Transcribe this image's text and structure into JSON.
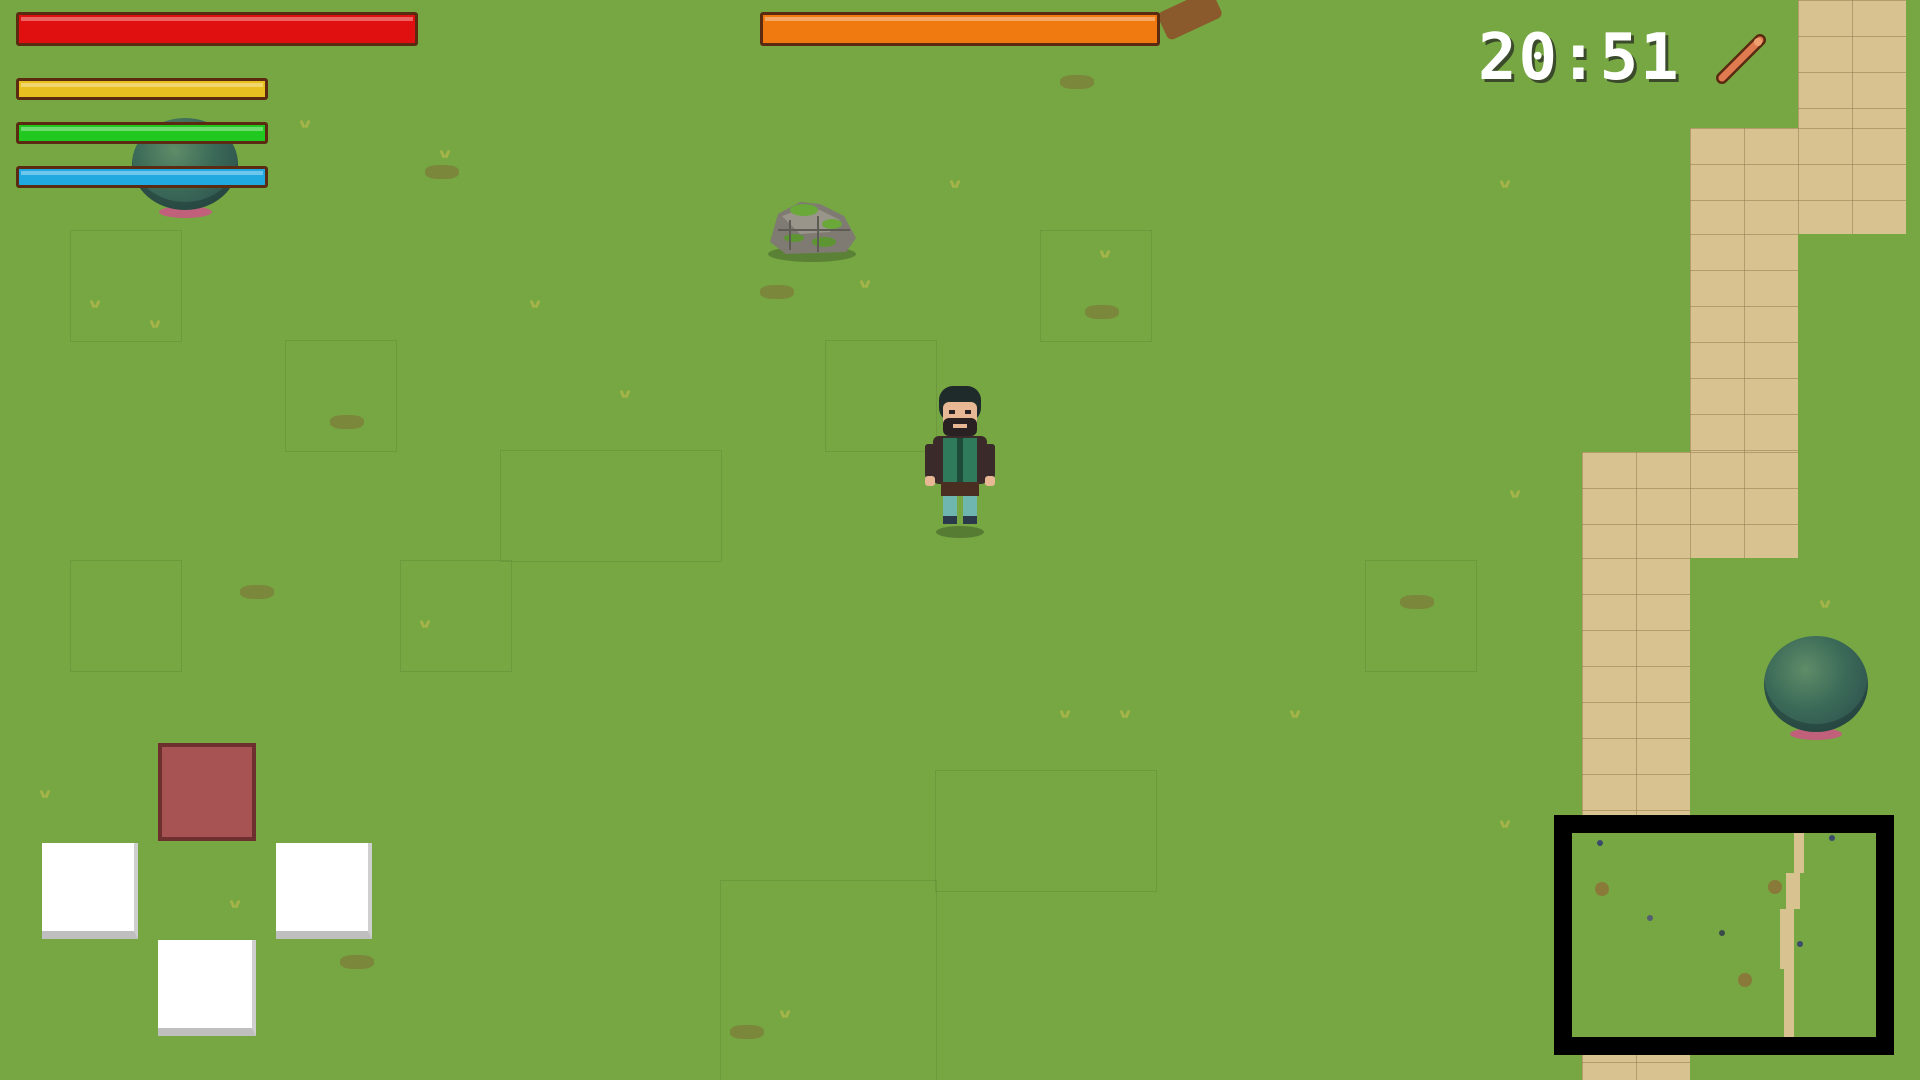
{
  "hud": {
    "clock_text": "20:51",
    "bars": [
      {
        "name": "health",
        "color": "#e01010",
        "level": 1.0
      },
      {
        "name": "boss-health",
        "color": "#f07a10",
        "level": 1.0
      },
      {
        "name": "stamina",
        "color": "#e8c020",
        "level": 1.0
      },
      {
        "name": "energy",
        "color": "#20c820",
        "level": 1.0
      },
      {
        "name": "mana",
        "color": "#20a8e0",
        "level": 1.0
      }
    ],
    "tool_icon": "pencil-icon"
  },
  "controls": {
    "up": {
      "icon": "dpad-up",
      "color": "#a85353"
    },
    "left": {
      "icon": "dpad-left",
      "color": "#ffffff"
    },
    "right": {
      "icon": "dpad-right",
      "color": "#ffffff"
    },
    "down": {
      "icon": "dpad-down",
      "color": "#ffffff"
    }
  },
  "scene": {
    "ground": "grass",
    "colors": {
      "grass": "#76a742",
      "path": "#d8c28f",
      "bush": "#3b6a58"
    }
  }
}
